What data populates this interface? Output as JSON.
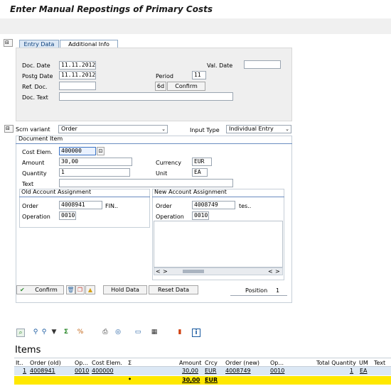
{
  "title": "Enter Manual Repostings of Primary Costs",
  "tabs": [
    "Entry Data",
    "Additional Info"
  ],
  "header": {
    "doc_date_label": "Doc. Date",
    "doc_date": "11.11.2012",
    "postg_date_label": "Postg Date",
    "postg_date": "11.11.2012",
    "ref_doc_label": "Ref. Doc.",
    "ref_doc": "",
    "doc_text_label": "Doc. Text",
    "doc_text": "",
    "val_date_label": "Val. Date",
    "val_date": "",
    "period_label": "Period",
    "period": "11",
    "confirm_label": "Confirm",
    "glasses_glyph": "6d"
  },
  "scrn": {
    "variant_label": "Scrn variant",
    "variant": "Order",
    "input_type_label": "Input Type",
    "input_type": "Individual Entry"
  },
  "doc_item": {
    "section_label": "Document Item",
    "cost_elem_label": "Cost Elem.",
    "cost_elem": "400000",
    "amount_label": "Amount",
    "amount": "30,00",
    "currency_label": "Currency",
    "currency": "EUR",
    "quantity_label": "Quantity",
    "quantity": "1",
    "unit_label": "Unit",
    "unit": "EA",
    "text_label": "Text",
    "text": ""
  },
  "old_assign": {
    "label": "Old Account Assignment",
    "order_label": "Order",
    "order": "4008941",
    "order_desc": "FIN..",
    "operation_label": "Operation",
    "operation": "0010"
  },
  "new_assign": {
    "label": "New Account Assignment",
    "order_label": "Order",
    "order": "4008749",
    "order_desc": "tes..",
    "operation_label": "Operation",
    "operation": "0010"
  },
  "actions": {
    "confirm": "Confirm",
    "hold": "Hold Data",
    "reset": "Reset Data",
    "position_label": "Position",
    "position": "1"
  },
  "items": {
    "heading": "Items",
    "columns": [
      "It..",
      "Order (old)",
      "Op...",
      "Cost Elem.",
      "Σ",
      "Amount",
      "Crcy",
      "Order (new)",
      "Op...",
      "Total Quantity",
      "UM",
      "Text"
    ],
    "rows": [
      {
        "it": "1",
        "order_old": "4008941",
        "op_old": "0010",
        "cost_elem": "400000",
        "amount": "30,00",
        "crcy": "EUR",
        "order_new": "4008749",
        "op_new": "0010",
        "qty": "1",
        "um": "EA",
        "text": ""
      }
    ],
    "total": {
      "marker": "•",
      "amount": "30,00",
      "crcy": "EUR"
    }
  },
  "colors": {
    "accent": "#0a3e7a",
    "total_row": "#ffe800",
    "selected_row": "#dce8f5"
  }
}
